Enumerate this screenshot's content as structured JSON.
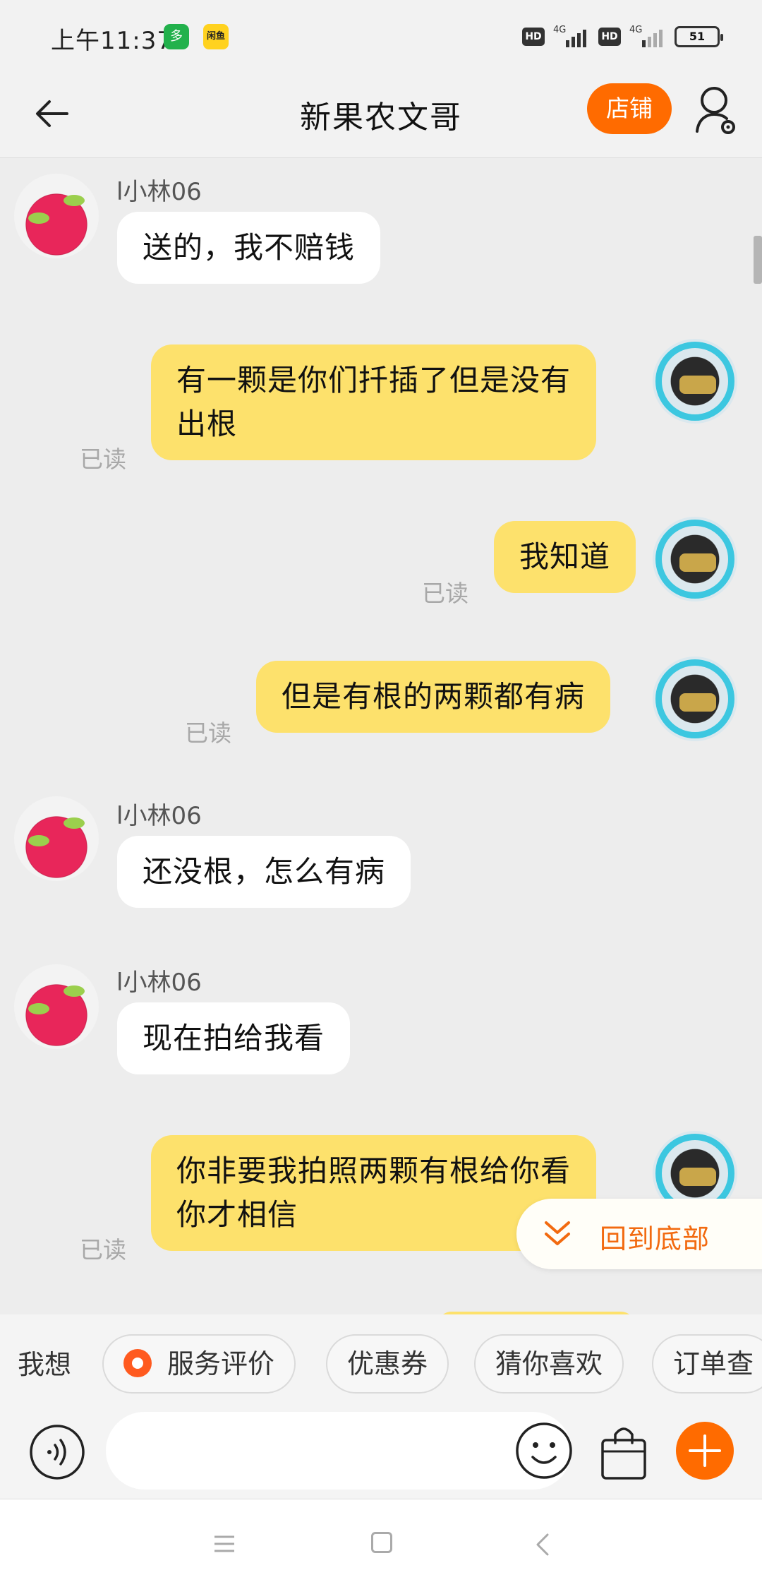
{
  "status_bar": {
    "time": "上午11:37",
    "app_icon_1": "多",
    "app_icon_2": "闲鱼",
    "hd_1": "HD",
    "network_1": "4G",
    "hd_2": "HD",
    "network_2": "4G",
    "battery": "51"
  },
  "header": {
    "title": "新果农文哥",
    "shop_button": "店铺",
    "back_icon": "arrow-left-icon",
    "profile_icon": "user-settings-icon"
  },
  "messages": [
    {
      "side": "left",
      "sender": "l小林06",
      "lines": [
        "送的，我不赔钱"
      ]
    },
    {
      "side": "right",
      "status": "已读",
      "lines": [
        "有一颗是你们扦插了但是没有",
        "出根"
      ]
    },
    {
      "side": "right",
      "status": "已读",
      "lines": [
        "我知道"
      ]
    },
    {
      "side": "right",
      "status": "已读",
      "lines": [
        "但是有根的两颗都有病"
      ]
    },
    {
      "side": "left",
      "sender": "l小林06",
      "lines": [
        "还没根，怎么有病"
      ]
    },
    {
      "side": "left",
      "sender": "l小林06",
      "lines": [
        "现在拍给我看"
      ]
    },
    {
      "side": "right",
      "status": "已读",
      "lines": [
        "你非要我拍照两颗有根给你看",
        "你才相信"
      ]
    }
  ],
  "scroll_to_bottom": {
    "label": "回到底部",
    "icon": "double-chevron-down-icon"
  },
  "quick_bar": {
    "label": "我想",
    "chips": [
      "服务评价",
      "优惠券",
      "猜你喜欢",
      "订单查"
    ]
  },
  "input_bar": {
    "text_value": "",
    "voice_icon": "voice-icon",
    "emoji_icon": "emoji-icon",
    "bag_icon": "shopping-bag-icon",
    "plus_icon": "plus-icon"
  },
  "colors": {
    "accent": "#ff6b00",
    "own_bubble": "#fde16c",
    "other_bubble": "#ffffff",
    "background": "#ededed"
  }
}
